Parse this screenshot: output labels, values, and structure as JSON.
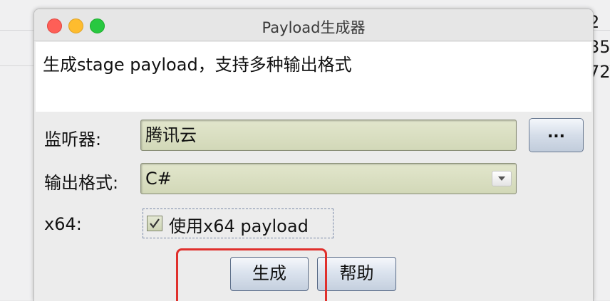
{
  "background": {
    "partial_numbers": [
      "2",
      "35",
      "72"
    ]
  },
  "window": {
    "title": "Payload生成器"
  },
  "description": "生成stage payload，支持多种输出格式",
  "form": {
    "listener_label": "监听器:",
    "listener_value": "腾讯云",
    "browse_button": "...",
    "format_label": "输出格式:",
    "format_value": "C#",
    "x64_label": "x64:",
    "x64_checkbox_label": "使用x64 payload",
    "x64_checked": true
  },
  "buttons": {
    "generate": "生成",
    "help": "帮助"
  },
  "colors": {
    "highlight": "#e0302c",
    "close": "#fe5f57",
    "minimize": "#febc2e",
    "maximize": "#28c840"
  }
}
